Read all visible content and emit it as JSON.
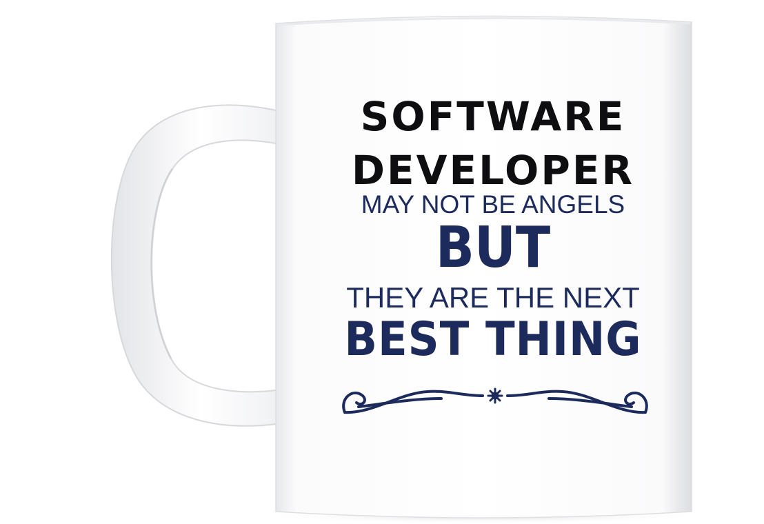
{
  "mug": {
    "body_color": "#ffffff",
    "shadow_color": "#d9dadf",
    "text_dark": "#0e0e10",
    "text_navy": "#1c2a5c",
    "ornament_icon": "flourish-divider-icon"
  },
  "print": {
    "line1": "SOFTWARE",
    "line2": "DEVELOPER",
    "line3": "MAY NOT BE ANGELS",
    "line4": "BUT",
    "line5": "THEY ARE THE NEXT",
    "line6": "BEST THING"
  }
}
